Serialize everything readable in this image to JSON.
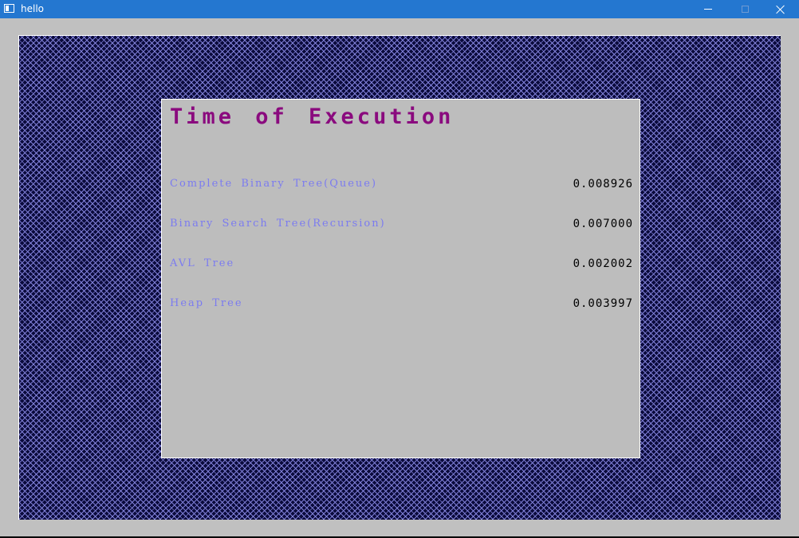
{
  "window": {
    "title": "hello",
    "controls": {
      "minimize": "minimize-icon",
      "maximize": "maximize-icon",
      "close": "close-icon"
    }
  },
  "colors": {
    "titlebar": "#2477d0",
    "background_pattern": "#0b0b3c",
    "pattern_lines": "#7f7fd6",
    "panel": "#bdbdbd",
    "heading": "#8a0a7e",
    "label": "#7b7bf0",
    "value": "#000000"
  },
  "panel": {
    "title": "Time of Execution",
    "rows": [
      {
        "label": "Complete Binary Tree(Queue)",
        "value": "0.008926"
      },
      {
        "label": "Binary Search Tree(Recursion)",
        "value": "0.007000"
      },
      {
        "label": "AVL Tree",
        "value": "0.002002"
      },
      {
        "label": "Heap Tree",
        "value": "0.003997"
      }
    ]
  }
}
